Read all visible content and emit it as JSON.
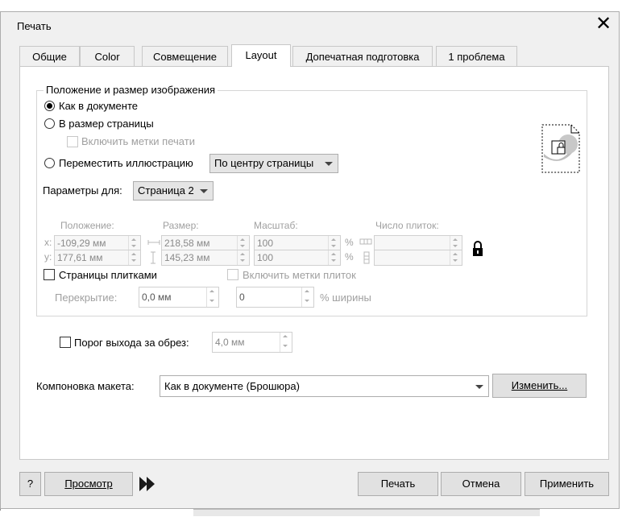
{
  "window": {
    "title": "Печать",
    "close_glyph": "✕"
  },
  "tabs": [
    {
      "label": "Общие"
    },
    {
      "label": "Color"
    },
    {
      "label": "Совмещение"
    },
    {
      "label": "Layout",
      "active": true
    },
    {
      "label": "Допечатная подготовка"
    },
    {
      "label": "1 проблема"
    }
  ],
  "position_group": {
    "title": "Положение и размер изображения",
    "as_in_document": "Как в документе",
    "fit_page": "В размер страницы",
    "include_marks": "Включить метки печати",
    "move_illustration": "Переместить иллюстрацию",
    "move_option": "По центру страницы",
    "params_for_label": "Параметры для:",
    "params_for_value": "Страница 2",
    "headers": {
      "position": "Положение:",
      "size": "Размер:",
      "scale": "Масштаб:",
      "tiles": "Число плиток:"
    },
    "x_label": "x:",
    "y_label": "y:",
    "x_value": "-109,29 мм",
    "y_value": "177,61 мм",
    "width_value": "218,58 мм",
    "height_value": "145,23 мм",
    "scale_x": "100",
    "scale_y": "100",
    "percent": "%",
    "tile_pages": "Страницы плитками",
    "include_tile_marks": "Включить метки плиток",
    "overlap_label": "Перекрытие:",
    "overlap_value": "0,0 мм",
    "overlap_pct_value": "0",
    "overlap_pct_suffix": "% ширины"
  },
  "bleed": {
    "label": "Порог выхода за обрез:",
    "value": "4,0 мм"
  },
  "layout": {
    "label": "Компоновка макета:",
    "value": "Как в документе (Брошюра)",
    "edit_button": "Изменить..."
  },
  "footer": {
    "help": "?",
    "preview": "Просмотр",
    "print": "Печать",
    "cancel": "Отмена",
    "apply": "Применить"
  }
}
